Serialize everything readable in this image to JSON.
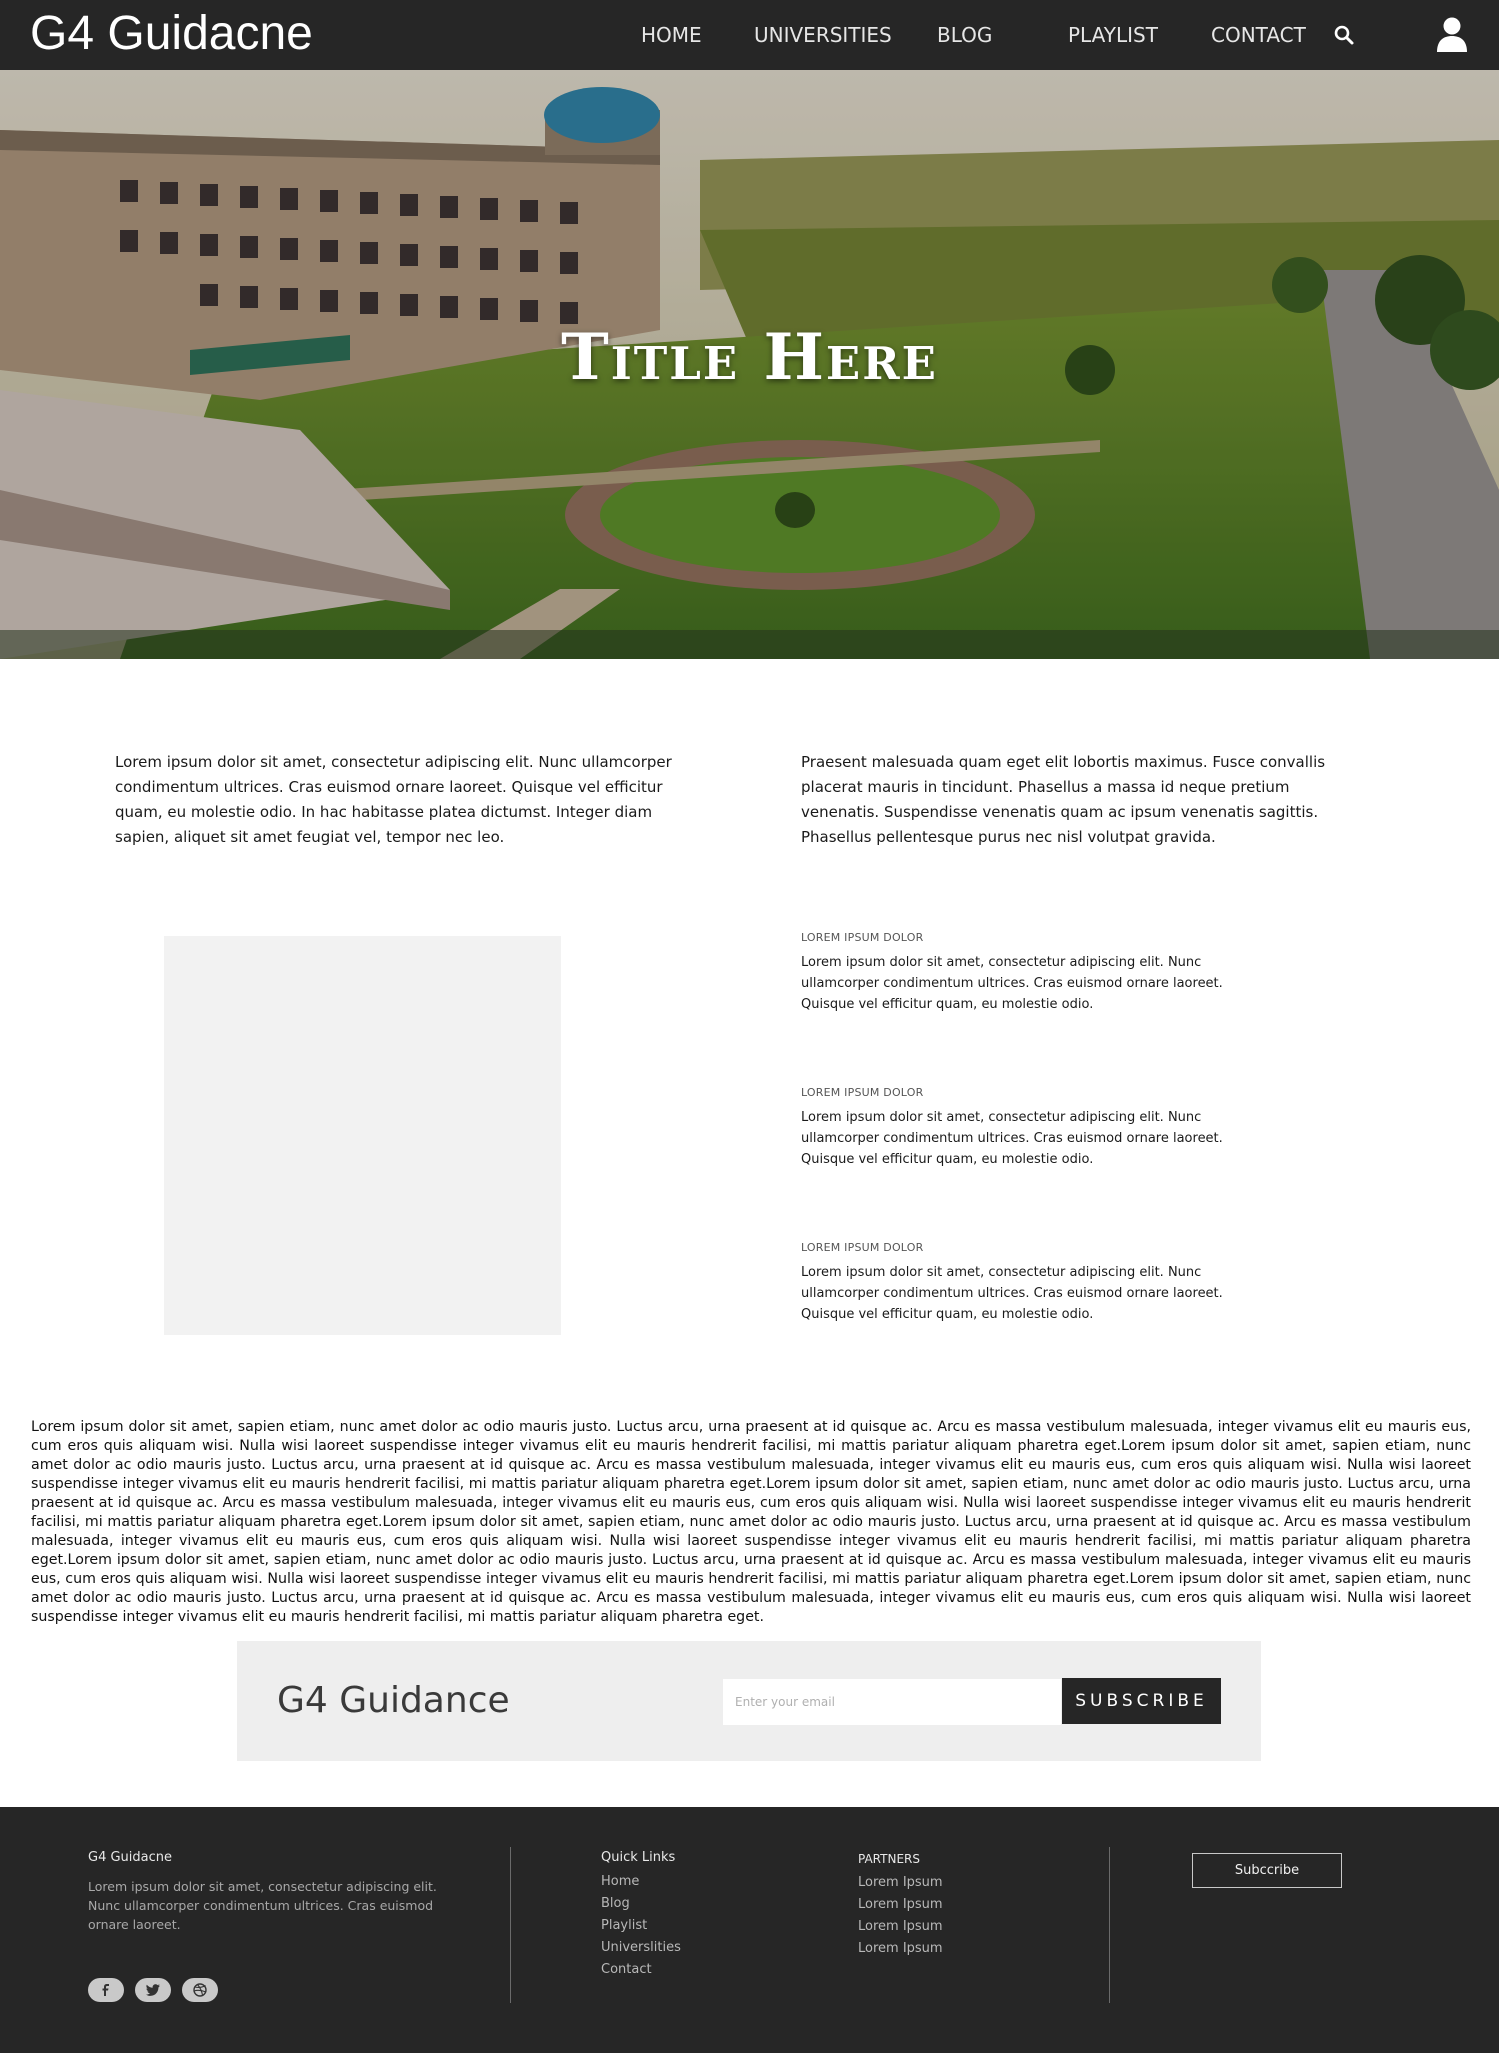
{
  "header": {
    "brand": "G4 Guidacne",
    "nav": [
      "HOME",
      "UNIVERSITIES",
      "BLOG",
      "PLAYLIST",
      "CONTACT"
    ],
    "search_icon": "search-icon",
    "user_icon": "user-icon"
  },
  "hero": {
    "title": "Title Here"
  },
  "intro": {
    "left": "Lorem ipsum dolor sit amet, consectetur adipiscing elit. Nunc ullamcorper condimentum ultrices. Cras euismod ornare laoreet. Quisque vel efficitur quam, eu molestie odio. In hac habitasse platea dictumst. Integer diam sapien, aliquet sit amet feugiat vel, tempor nec leo.",
    "right": "Praesent malesuada quam eget elit lobortis maximus. Fusce convallis placerat mauris in tincidunt. Phasellus a massa id neque pretium venenatis. Suspendisse venenatis quam ac ipsum venenatis sagittis. Phasellus pellentesque purus nec nisl volutpat gravida."
  },
  "features": [
    {
      "title": "LOREM IPSUM DOLOR",
      "text": "Lorem ipsum dolor sit amet, consectetur adipiscing elit. Nunc ullamcorper condimentum ultrices. Cras euismod ornare laoreet. Quisque vel efficitur quam, eu molestie odio."
    },
    {
      "title": "LOREM IPSUM DOLOR",
      "text": "Lorem ipsum dolor sit amet, consectetur adipiscing elit. Nunc ullamcorper condimentum ultrices. Cras euismod ornare laoreet. Quisque vel efficitur quam, eu molestie odio."
    },
    {
      "title": "LOREM IPSUM DOLOR",
      "text": "Lorem ipsum dolor sit amet, consectetur adipiscing elit. Nunc ullamcorper condimentum ultrices. Cras euismod ornare laoreet. Quisque vel efficitur quam, eu molestie odio."
    }
  ],
  "long_text": "Lorem ipsum dolor sit amet, sapien etiam, nunc amet dolor ac odio mauris justo. Luctus arcu, urna praesent at id quisque ac. Arcu es massa vestibulum malesuada, integer vivamus elit eu mauris eus, cum eros quis aliquam wisi. Nulla wisi laoreet suspendisse integer vivamus elit eu mauris hendrerit facilisi, mi mattis pariatur aliquam pharetra eget.Lorem ipsum dolor sit amet, sapien etiam, nunc amet dolor ac odio mauris justo. Luctus arcu, urna praesent at id quisque ac. Arcu es massa vestibulum malesuada, integer vivamus elit eu mauris eus, cum eros quis aliquam wisi. Nulla wisi laoreet suspendisse integer vivamus elit eu mauris hendrerit facilisi, mi mattis pariatur aliquam pharetra eget.Lorem ipsum dolor sit amet, sapien etiam, nunc amet dolor ac odio mauris justo. Luctus arcu, urna praesent at id quisque ac. Arcu es massa vestibulum malesuada, integer vivamus elit eu mauris eus, cum eros quis aliquam wisi. Nulla wisi laoreet suspendisse integer vivamus elit eu mauris hendrerit facilisi, mi mattis pariatur aliquam pharetra eget.Lorem ipsum dolor sit amet, sapien etiam, nunc amet dolor ac odio mauris justo. Luctus arcu, urna praesent at id quisque ac. Arcu es massa vestibulum malesuada, integer vivamus elit eu mauris eus, cum eros quis aliquam wisi. Nulla wisi laoreet suspendisse integer vivamus elit eu mauris hendrerit facilisi, mi mattis pariatur aliquam pharetra eget.Lorem ipsum dolor sit amet, sapien etiam, nunc amet dolor ac odio mauris justo. Luctus arcu, urna praesent at id quisque ac. Arcu es massa vestibulum malesuada, integer vivamus elit eu mauris eus, cum eros quis aliquam wisi. Nulla wisi laoreet suspendisse integer vivamus elit eu mauris hendrerit facilisi, mi mattis pariatur aliquam pharetra eget.Lorem ipsum dolor sit amet, sapien etiam, nunc amet dolor ac odio mauris justo. Luctus arcu, urna praesent at id quisque ac. Arcu es massa vestibulum malesuada, integer vivamus elit eu mauris eus, cum eros quis aliquam wisi. Nulla wisi laoreet suspendisse integer vivamus elit eu mauris hendrerit facilisi, mi mattis pariatur aliquam pharetra eget.",
  "subscribe_banner": {
    "title": "G4 Guidance",
    "placeholder": "Enter your email",
    "button": "SUBSCRIBE"
  },
  "footer": {
    "brand": "G4 Guidacne",
    "description": "Lorem ipsum dolor sit amet, consectetur adipiscing elit. Nunc ullamcorper condimentum ultrices. Cras euismod ornare laoreet.",
    "quick_links_title": "Quick Links",
    "quick_links": [
      "Home",
      "Blog",
      "Playlist",
      "Universlities",
      "Contact"
    ],
    "partners_title": "PARTNERS",
    "partners": [
      "Lorem Ipsum",
      "Lorem Ipsum",
      "Lorem Ipsum",
      "Lorem Ipsum"
    ],
    "subscribe_button": "Subccribe",
    "social_icons": [
      "facebook-icon",
      "twitter-icon",
      "dribbble-icon"
    ]
  },
  "colors": {
    "nav_bg": "#262626",
    "banner_bg": "#eeeeee",
    "placeholder_bg": "#f2f2f2",
    "footer_bg": "#262626"
  }
}
